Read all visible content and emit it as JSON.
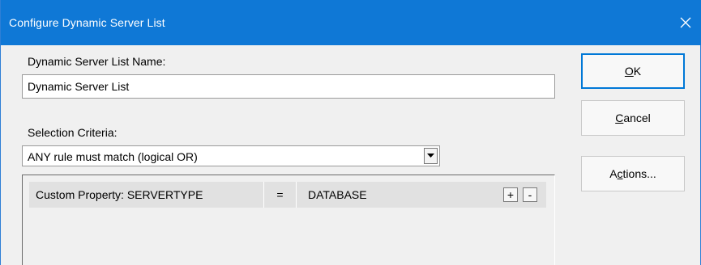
{
  "window": {
    "title": "Configure Dynamic Server List",
    "close_icon": "close-icon"
  },
  "name_field": {
    "label": "Dynamic Server List Name:",
    "value": "Dynamic Server List"
  },
  "selection": {
    "label": "Selection Criteria:",
    "value": "ANY rule must match (logical OR)"
  },
  "rules": [
    {
      "property": "Custom Property: SERVERTYPE",
      "operator": "=",
      "value": "DATABASE",
      "add_label": "+",
      "remove_label": "-"
    }
  ],
  "buttons": {
    "ok": {
      "mnemonic": "O",
      "rest": "K"
    },
    "cancel": {
      "mnemonic": "C",
      "rest": "ancel"
    },
    "actions": {
      "before": "A",
      "mnemonic": "c",
      "after": "tions..."
    }
  },
  "colors": {
    "titlebar": "#0f78d6",
    "accent": "#0078d7"
  }
}
